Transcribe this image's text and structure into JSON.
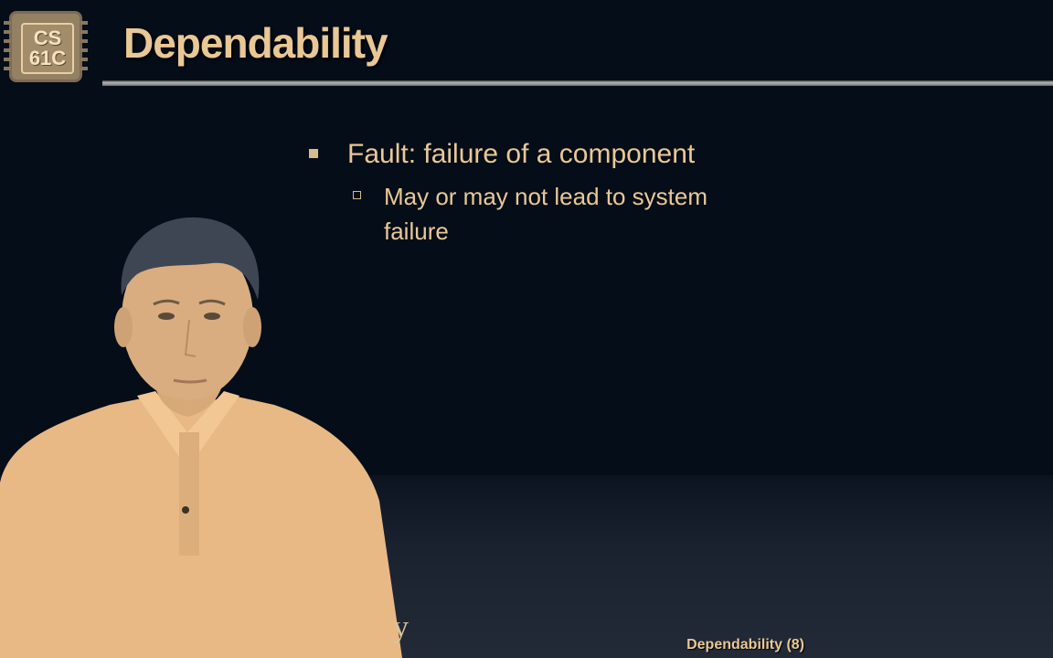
{
  "logo": {
    "line1": "CS",
    "line2": "61C"
  },
  "slide": {
    "title": "Dependability",
    "bullets": [
      {
        "text": "Fault: failure of a component",
        "sub": [
          "May or may not lead to system failure"
        ]
      }
    ],
    "footer": "Dependability (8)",
    "stray_glyph": "y"
  },
  "colors": {
    "background": "#050d19",
    "accent_text": "#e9c896",
    "skin_tone": "#e8b985",
    "hair": "#3e4654"
  },
  "icons": {
    "logo": "cs61c-chip-logo",
    "bullet_level1": "filled-square-bullet",
    "bullet_level2": "hollow-square-bullet"
  }
}
